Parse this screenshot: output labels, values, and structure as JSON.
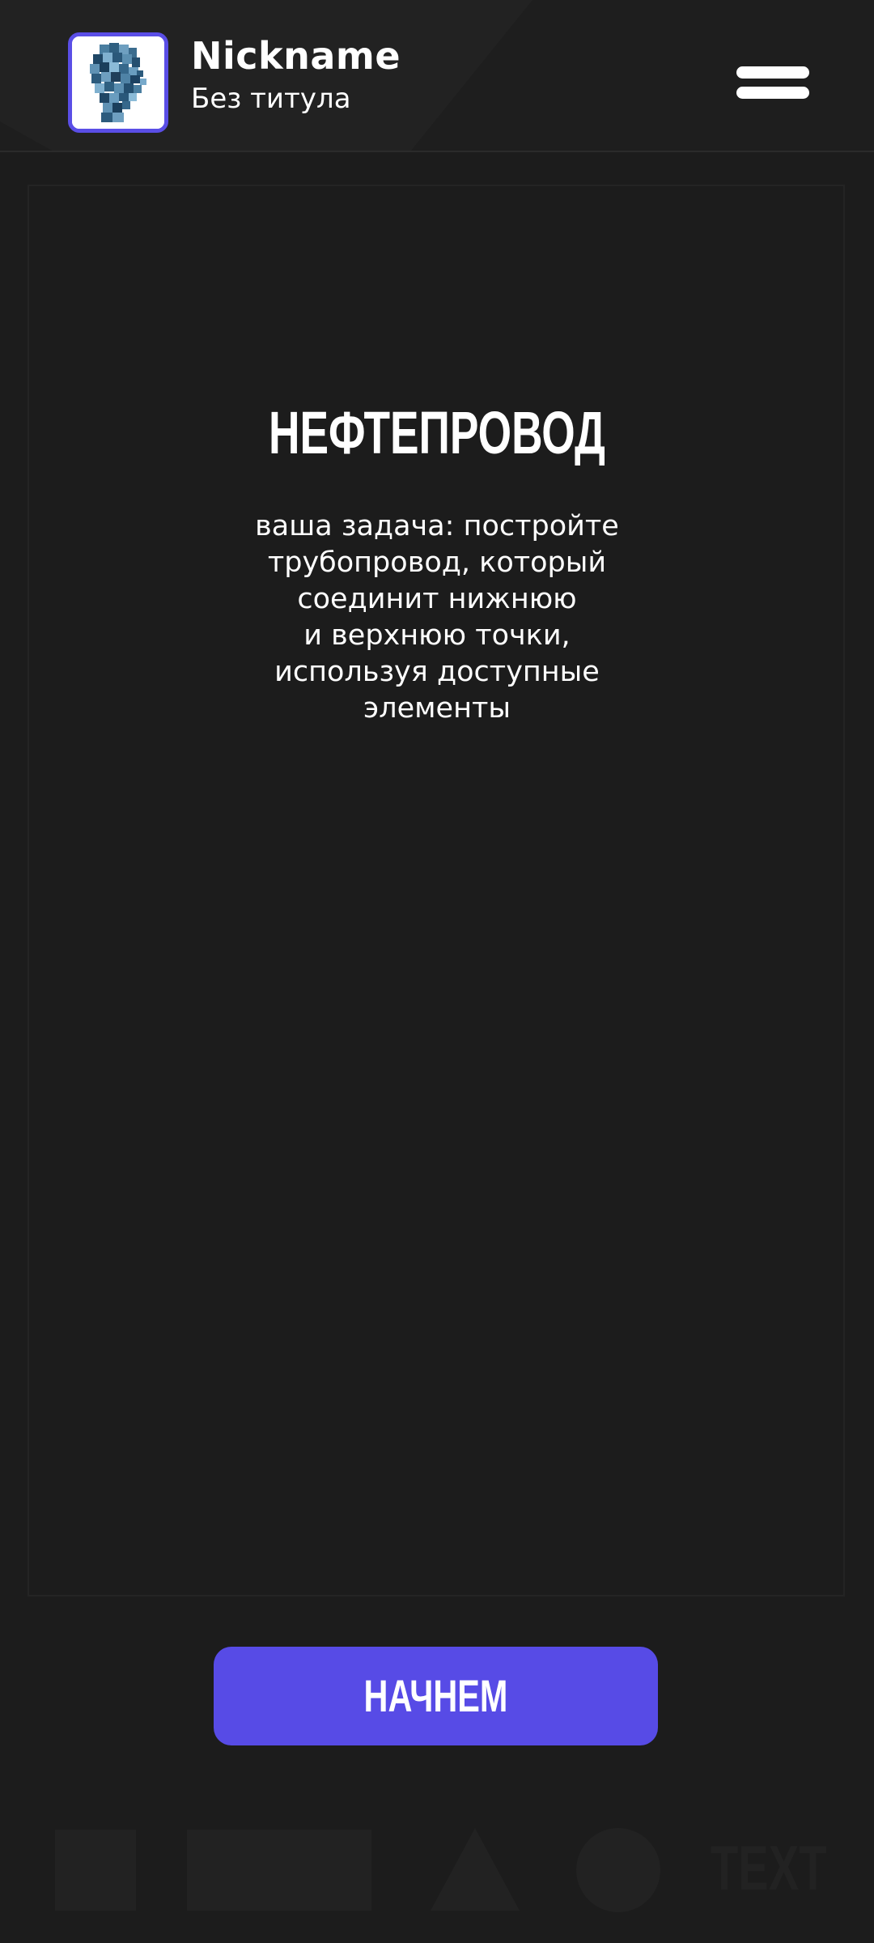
{
  "header": {
    "nickname": "Nickname",
    "user_title": "Без титула",
    "avatar_icon": "pixel-head-avatar",
    "menu_icon": "hamburger-menu-icon"
  },
  "game": {
    "title": "НЕФТЕПРОВОД",
    "description_lines": [
      "ваша задача: постройте",
      "трубопровод, который",
      "соединит нижнюю",
      "и верхнюю точки,",
      "используя доступные",
      "элементы"
    ]
  },
  "actions": {
    "start_label": "НАЧНЕМ"
  },
  "footer_shapes": {
    "text_label": "TEXT"
  },
  "colors": {
    "background": "#1c1c1c",
    "header_background": "#1e1e1e",
    "accent": "#574be6",
    "avatar_border": "#5a4ee6",
    "text": "#ffffff",
    "decor_shape": "#222222"
  }
}
